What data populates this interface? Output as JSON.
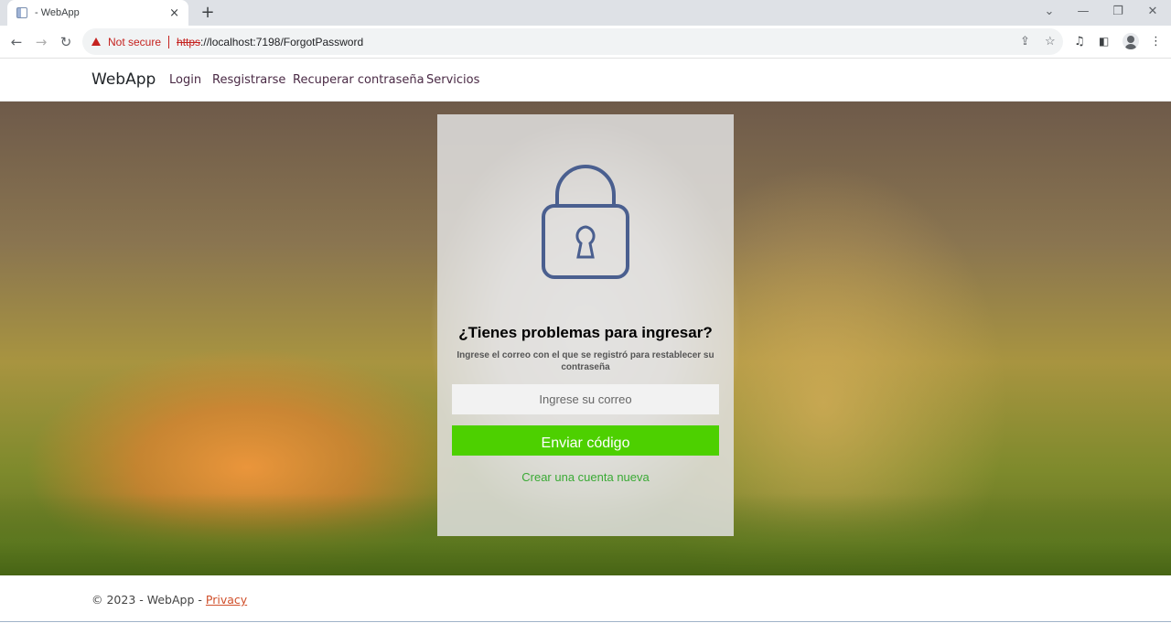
{
  "browser": {
    "tab_title": "- WebApp",
    "tab_close": "×",
    "new_tab": "+",
    "window_controls": {
      "minimize": "—",
      "restore": "❐",
      "close": "✕",
      "dropdown": "⌄"
    },
    "nav": {
      "back": "←",
      "forward": "→",
      "reload": "↻"
    },
    "security_label": "Not secure",
    "url_scheme": "https",
    "url_rest": "://localhost:7198/ForgotPassword",
    "icons": [
      "share-icon",
      "star-icon",
      "media-icon",
      "sidepanel-icon",
      "profile-icon",
      "menu-icon"
    ]
  },
  "site": {
    "brand": "WebApp",
    "nav": [
      "Login",
      "Resgistrarse",
      "Recuperar contraseña",
      "Servicios"
    ]
  },
  "card": {
    "icon": "lock-icon",
    "title": "¿Tienes problemas para ingresar?",
    "subtitle": "Ingrese el correo con el que se registró para restablecer su contraseña",
    "email_placeholder": "Ingrese su correo",
    "submit_label": "Enviar código",
    "create_account": "Crear una cuenta nueva",
    "colors": {
      "button": "#4dd000",
      "link": "#3aaa35",
      "lock": "#4a5f8f"
    }
  },
  "footer": {
    "copyright": "© 2023 - WebApp -",
    "privacy": "Privacy"
  }
}
